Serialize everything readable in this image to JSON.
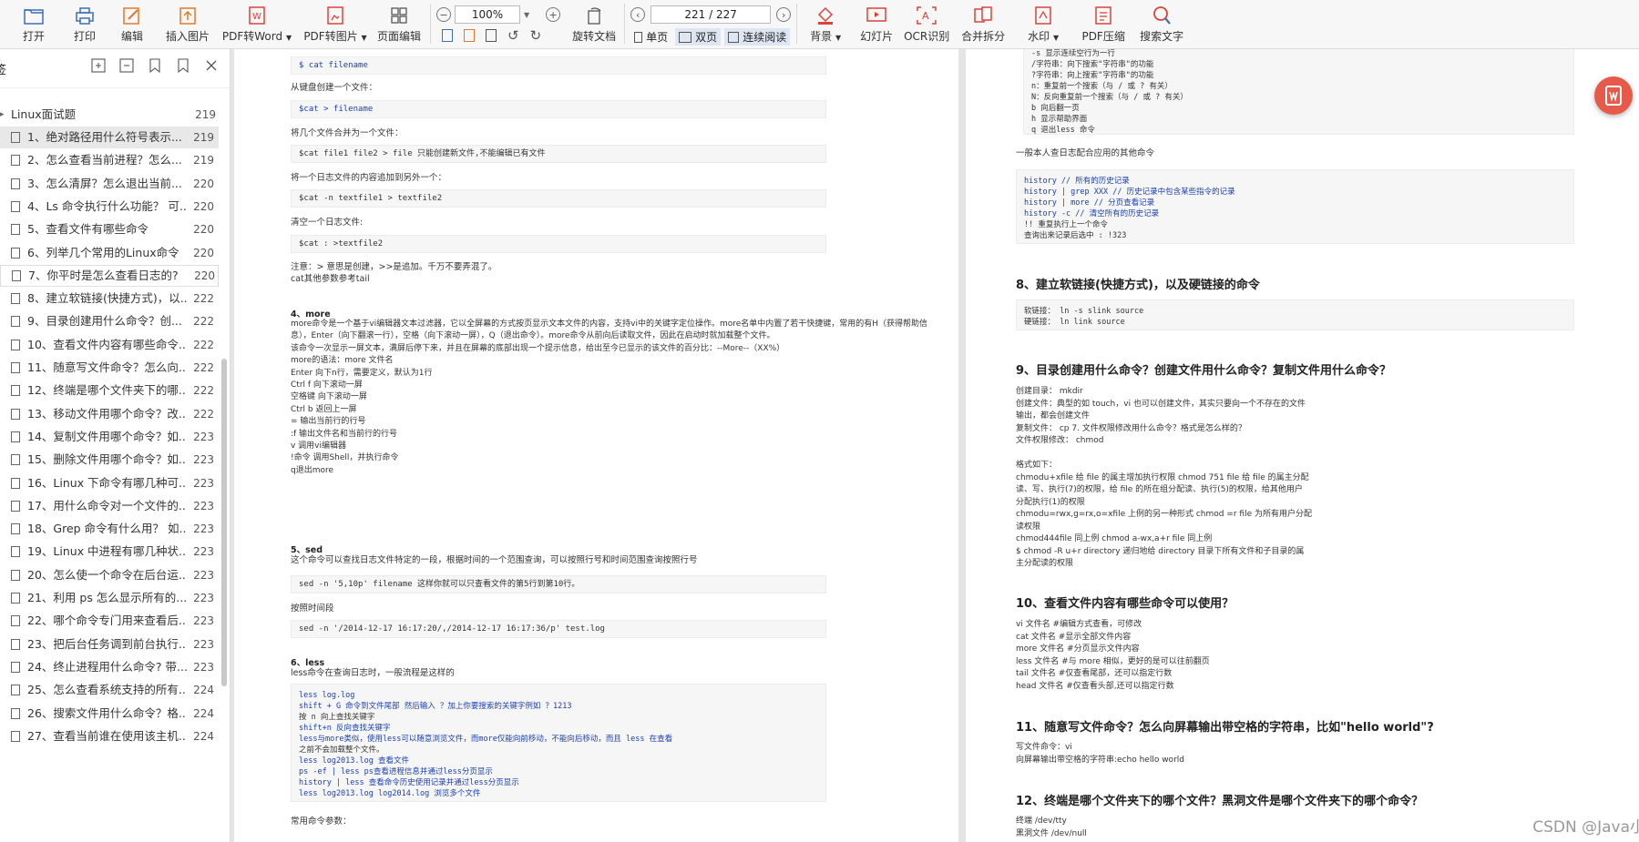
{
  "toolbar": {
    "open": "打开",
    "print": "打印",
    "edit": "编辑",
    "insert_image": "插入图片",
    "pdf_to_word": "PDF转Word",
    "pdf_to_image": "PDF转图片",
    "page_edit": "页面编辑",
    "zoom": "100%",
    "page_indicator": "221 / 227",
    "rotate": "旋转文档",
    "single_page": "单页",
    "double_page": "双页",
    "continuous": "连续阅读",
    "background": "背景",
    "slideshow": "幻灯片",
    "ocr": "OCR识别",
    "merge_split": "合并拆分",
    "watermark": "水印",
    "pdf_compress": "PDF压缩",
    "search_text": "搜索文字"
  },
  "sidebar": {
    "title": "签",
    "root": {
      "label": "Linux面试题",
      "page": "219"
    },
    "items": [
      {
        "label": "1、绝对路径用什么符号表示...",
        "page": "219"
      },
      {
        "label": "2、怎么查看当前进程？怎么...",
        "page": "219"
      },
      {
        "label": "3、怎么清屏？怎么退出当前...",
        "page": "220"
      },
      {
        "label": "4、Ls 命令执行什么功能？ 可...",
        "page": "220"
      },
      {
        "label": "5、查看文件有哪些命令",
        "page": "220"
      },
      {
        "label": "6、列举几个常用的Linux命令",
        "page": "220"
      },
      {
        "label": "7、你平时是怎么查看日志的?",
        "page": "220"
      },
      {
        "label": "8、建立软链接(快捷方式)，以...",
        "page": "222"
      },
      {
        "label": "9、目录创建用什么命令？创...",
        "page": "222"
      },
      {
        "label": "10、查看文件内容有哪些命令...",
        "page": "222"
      },
      {
        "label": "11、随意写文件命令？怎么向...",
        "page": "222"
      },
      {
        "label": "12、终端是哪个文件夹下的哪...",
        "page": "222"
      },
      {
        "label": "13、移动文件用哪个命令？改...",
        "page": "222"
      },
      {
        "label": "14、复制文件用哪个命令？如...",
        "page": "223"
      },
      {
        "label": "15、删除文件用哪个命令？如...",
        "page": "223"
      },
      {
        "label": "16、Linux 下命令有哪几种可...",
        "page": "223"
      },
      {
        "label": "17、用什么命令对一个文件的...",
        "page": "223"
      },
      {
        "label": "18、Grep 命令有什么用？ 如...",
        "page": "223"
      },
      {
        "label": "19、Linux 中进程有哪几种状...",
        "page": "223"
      },
      {
        "label": "20、怎么使一个命令在后台运...",
        "page": "223"
      },
      {
        "label": "21、利用 ps 怎么显示所有的...",
        "page": "223"
      },
      {
        "label": "22、哪个命令专门用来查看后...",
        "page": "223"
      },
      {
        "label": "23、把后台任务调到前台执行...",
        "page": "223"
      },
      {
        "label": "24、终止进程用什么命令? 带...",
        "page": "223"
      },
      {
        "label": "25、怎么查看系统支持的所有...",
        "page": "224"
      },
      {
        "label": "26、搜索文件用什么命令？格...",
        "page": "224"
      },
      {
        "label": "27、查看当前谁在使用该主机...",
        "page": "224"
      }
    ]
  },
  "left_page": {
    "code1": "$ cat filename",
    "t_keyboard": "从键盘创建一个文件：",
    "code2": "$cat > filename",
    "t_merge": "将几个文件合并为一个文件：",
    "code3": "$cat file1 file2 > file 只能创建新文件,不能编辑已有文件",
    "t_append": "将一个日志文件的内容追加到另外一个：",
    "code4": "$cat -n textfile1 > textfile2",
    "t_clear": "清空一个日志文件:",
    "code5": "$cat : >textfile2",
    "note1": "注意：> 意思是创建，>>是追加。千万不要弄混了。",
    "note2": "cat其他参数参考tail",
    "more_title": "4、more",
    "more_lines": [
      "more命令是一个基于vi编辑器文本过滤器，它以全屏幕的方式按页显示文本文件的内容，支持vi中的关键字定位操作。more名单中内置了若干快捷键，常用的有H（获得帮助信",
      "息），Enter（向下翻滚一行），空格（向下滚动一屏），Q（退出命令）。more命令从前向后读取文件，因此在启动时就加载整个文件。",
      "该命令一次显示一屏文本，满屏后停下来，并且在屏幕的底部出现一个提示信息，给出至今已显示的该文件的百分比：--More--（XX%）",
      "more的语法：more 文件名",
      "Enter 向下n行，需要定义，默认为1行",
      "Ctrl f 向下滚动一屏",
      "空格键 向下滚动一屏",
      "Ctrl b 返回上一屏",
      "= 输出当前行的行号",
      ":f 输出文件名和当前行的行号",
      "v 调用vi编辑器",
      "!命令 调用Shell，并执行命令",
      "q退出more"
    ],
    "sed_title": "5、sed",
    "sed_desc": "这个命令可以查找日志文件特定的一段，根据时间的一个范围查询，可以按照行号和时间范围查询按照行号",
    "code6": "sed -n '5,10p' filename 这样你就可以只查看文件的第5行到第10行。",
    "t_time": "按照时间段",
    "code7": "sed -n '/2014-12-17 16:17:20/,/2014-12-17 16:17:36/p' test.log",
    "less_title": "6、less",
    "less_desc": "less命令在查询日志时，一般流程是这样的",
    "less_code": [
      "less log.log",
      "shift + G 命令到文件尾部 然后输入 ？加上你要搜索的关键字例如 ？1213",
      "按 n 向上查找关键字",
      "shift+n 反向查找关键字",
      "less与more类似，使用less可以随意浏览文件，而more仅能向前移动，不能向后移动，而且 less 在查看",
      "之前不会加载整个文件。",
      "less log2013.log 查看文件",
      "ps -ef | less ps查看进程信息并通过less分页显示",
      "history | less 查看命令历史使用记录并通过less分页显示",
      "less log2013.log log2014.log 浏览多个文件"
    ],
    "t_params": "常用命令参数："
  },
  "right_page": {
    "top_code": [
      "-s 显示连续空行为一行",
      "/字符串：向下搜索\"字符串\"的功能",
      "?字符串：向上搜索\"字符串\"的功能",
      "n：重复前一个搜索（与 / 或 ? 有关）",
      "N：反向重复前一个搜索（与 / 或 ? 有关）",
      "b 向后翻一页",
      "h 显示帮助界面",
      "q 退出less 命令"
    ],
    "t_history": "一般本人查日志配合应用的其他命令",
    "history_code": [
      "history // 所有的历史记录",
      "history | grep XXX // 历史记录中包含某些指令的记录",
      "history | more // 分页查看记录",
      "history -c // 清空所有的历史记录",
      "!! 重复执行上一个命令",
      "查询出来记录后选中 : !323"
    ],
    "h8": "8、建立软链接(快捷方式)，以及硬链接的命令",
    "link_code": [
      "软链接： ln -s slink source",
      "硬链接： ln link source"
    ],
    "h9": "9、目录创建用什么命令？创建文件用什么命令？复制文件用什么命令？",
    "q9_lines": [
      " 创建目录： mkdir",
      "创建文件：典型的如 touch，vi 也可以创建文件，其实只要向一个不存在的文件",
      "输出，都会创建文件",
      "复制文件： cp 7. 文件权限修改用什么命令？格式是怎么样的？",
      "文件权限修改： chmod",
      "",
      "格式如下：",
      "chmodu+xfile 给 file 的属主增加执行权限 chmod 751 file 给 file 的属主分配",
      "读、写、执行(7)的权限，给 file 的所在组分配读、执行(5)的权限，给其他用户",
      "分配执行(1)的权限",
      "chmodu=rwx,g=rx,o=xfile 上例的另一种形式 chmod =r file 为所有用户分配",
      "读权限",
      "chmod444file 同上例 chmod a-wx,a+r file 同上例",
      "$ chmod -R u+r directory 递归地给 directory 目录下所有文件和子目录的属",
      "主分配读的权限"
    ],
    "h10": "10、查看文件内容有哪些命令可以使用？",
    "q10_lines": [
      "vi 文件名 #编辑方式查看，可修改",
      "cat 文件名 #显示全部文件内容",
      "more 文件名 #分页显示文件内容",
      "less 文件名 #与 more 相似，更好的是可以往前翻页",
      "tail 文件名 #仅查看尾部，还可以指定行数",
      "head 文件名 #仅查看头部,还可以指定行数"
    ],
    "h11": "11、随意写文件命令？怎么向屏幕输出带空格的字符串，比如\"hello world\"?",
    "q11_lines": [
      "写文件命令：vi",
      "向屏幕输出带空格的字符串:echo hello world"
    ],
    "h12": "12、终端是哪个文件夹下的哪个文件？黑洞文件是哪个文件夹下的哪个命令？",
    "q12_lines": [
      "终端 /dev/tty",
      "黑洞文件 /dev/null"
    ]
  },
  "watermark": "CSDN @Java小叮当",
  "colors": {
    "accent": "#e65a4a",
    "code_keyword": "#1a3fb0",
    "toolbar_bg": "#f7f7f7"
  }
}
